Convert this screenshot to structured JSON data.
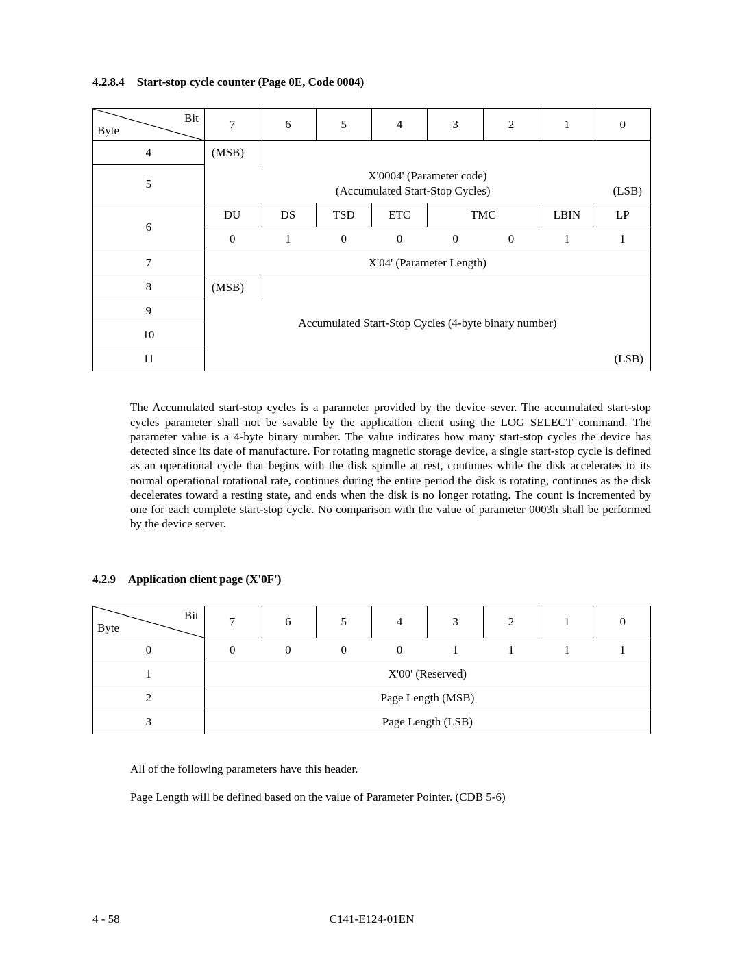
{
  "section1": {
    "num": "4.2.8.4",
    "title": "Start-stop cycle counter (Page 0E, Code 0004)"
  },
  "table1": {
    "diag_bit": "Bit",
    "diag_byte": "Byte",
    "bits": [
      "7",
      "6",
      "5",
      "4",
      "3",
      "2",
      "1",
      "0"
    ],
    "rows": {
      "r4": {
        "byte": "4",
        "msb": "(MSB)"
      },
      "r5": {
        "byte": "5",
        "line1": "X'0004' (Parameter code)",
        "line2": "(Accumulated Start-Stop Cycles)",
        "lsb": "(LSB)"
      },
      "r6a": {
        "byte": "6",
        "cells": [
          "DU",
          "DS",
          "TSD",
          "ETC",
          "TMC",
          "",
          "LBIN",
          "LP"
        ]
      },
      "r6b": {
        "cells": [
          "0",
          "1",
          "0",
          "0",
          "0",
          "0",
          "1",
          "1"
        ]
      },
      "r7": {
        "byte": "7",
        "text": "X'04' (Parameter Length)"
      },
      "r8": {
        "byte": "8",
        "msb": "(MSB)"
      },
      "r9": {
        "byte": "9"
      },
      "body": "Accumulated Start-Stop Cycles (4-byte binary number)",
      "r10": {
        "byte": "10"
      },
      "r11": {
        "byte": "11",
        "lsb": "(LSB)"
      }
    }
  },
  "para1": "The Accumulated start-stop cycles is a parameter provided by the device sever.  The accumulated start-stop cycles parameter shall not be savable by the application client using the LOG SELECT command.  The parameter value is a 4-byte binary number.  The value indicates how many start-stop cycles the device has detected since its date of manufacture.  For rotating magnetic storage device, a single start-stop cycle is defined as an operational cycle that begins with the disk spindle at rest, continues while the disk accelerates to its normal operational rotational rate, continues during the entire period the disk is rotating, continues as the disk decelerates toward a resting state, and ends when the disk is no longer rotating.  The count is incremented by one for each complete start-stop cycle.  No comparison with the value of parameter 0003h shall be performed by the device server.",
  "section2": {
    "num": "4.2.9",
    "title": "Application client page (X'0F')"
  },
  "table2": {
    "diag_bit": "Bit",
    "diag_byte": "Byte",
    "bits": [
      "7",
      "6",
      "5",
      "4",
      "3",
      "2",
      "1",
      "0"
    ],
    "r0": {
      "byte": "0",
      "cells": [
        "0",
        "0",
        "0",
        "0",
        "1",
        "1",
        "1",
        "1"
      ]
    },
    "r1": {
      "byte": "1",
      "text": "X'00' (Reserved)"
    },
    "r2": {
      "byte": "2",
      "text": "Page Length (MSB)"
    },
    "r3": {
      "byte": "3",
      "text": "Page Length (LSB)"
    }
  },
  "para2": "All of the following parameters have this header.",
  "para3": "Page Length will be defined based on the value of Parameter Pointer.  (CDB 5-6)",
  "footer": {
    "left": "4 - 58",
    "center": "C141-E124-01EN"
  },
  "chart_data": [
    {
      "type": "table",
      "title": "Start-stop cycle counter (Page 0E, Code 0004)",
      "columns": [
        "Byte",
        "Bit7",
        "Bit6",
        "Bit5",
        "Bit4",
        "Bit3",
        "Bit2",
        "Bit1",
        "Bit0"
      ],
      "rows": [
        [
          "4",
          "(MSB)",
          "",
          "",
          "",
          "",
          "",
          "",
          ""
        ],
        [
          "5",
          "",
          "",
          "X'0004' (Parameter code) / (Accumulated Start-Stop Cycles)",
          "",
          "",
          "",
          "",
          "(LSB)"
        ],
        [
          "6",
          "DU",
          "DS",
          "TSD",
          "ETC",
          "TMC",
          "TMC",
          "LBIN",
          "LP"
        ],
        [
          "6 (val)",
          "0",
          "1",
          "0",
          "0",
          "0",
          "0",
          "1",
          "1"
        ],
        [
          "7",
          "",
          "",
          "",
          "X'04' (Parameter Length)",
          "",
          "",
          "",
          ""
        ],
        [
          "8",
          "(MSB)",
          "",
          "",
          "",
          "",
          "",
          "",
          ""
        ],
        [
          "9",
          "",
          "",
          "",
          "Accumulated Start-Stop Cycles (4-byte binary number)",
          "",
          "",
          "",
          ""
        ],
        [
          "10",
          "",
          "",
          "",
          "",
          "",
          "",
          "",
          ""
        ],
        [
          "11",
          "",
          "",
          "",
          "",
          "",
          "",
          "",
          "(LSB)"
        ]
      ]
    },
    {
      "type": "table",
      "title": "Application client page (X'0F')",
      "columns": [
        "Byte",
        "Bit7",
        "Bit6",
        "Bit5",
        "Bit4",
        "Bit3",
        "Bit2",
        "Bit1",
        "Bit0"
      ],
      "rows": [
        [
          "0",
          "0",
          "0",
          "0",
          "0",
          "1",
          "1",
          "1",
          "1"
        ],
        [
          "1",
          "",
          "",
          "",
          "X'00' (Reserved)",
          "",
          "",
          "",
          ""
        ],
        [
          "2",
          "",
          "",
          "",
          "Page Length (MSB)",
          "",
          "",
          "",
          ""
        ],
        [
          "3",
          "",
          "",
          "",
          "Page Length (LSB)",
          "",
          "",
          "",
          ""
        ]
      ]
    }
  ]
}
